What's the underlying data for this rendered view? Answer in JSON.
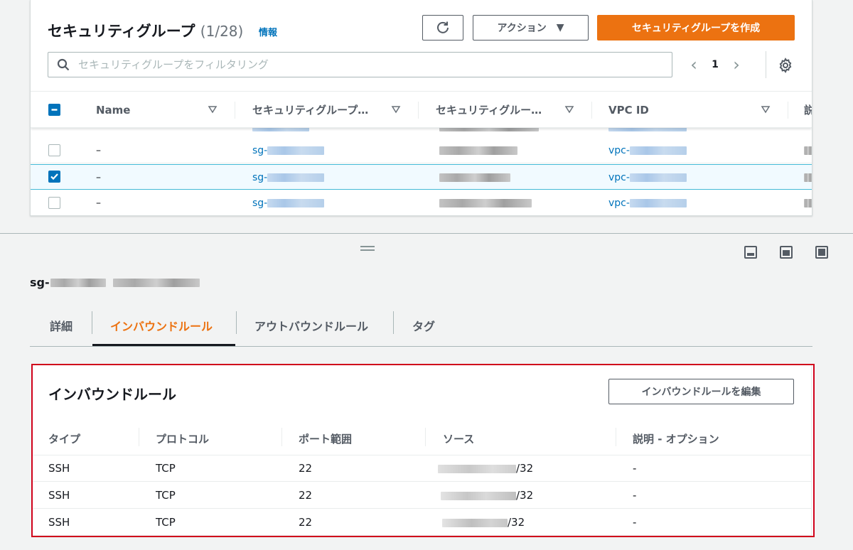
{
  "header": {
    "title": "セキュリティグループ",
    "count": "(1/28)",
    "info": "情報",
    "actions_label": "アクション",
    "create_label": "セキュリティグループを作成"
  },
  "search": {
    "placeholder": "セキュリティグループをフィルタリング",
    "value": ""
  },
  "pagination": {
    "current_page": "1"
  },
  "table": {
    "columns": [
      "Name",
      "セキュリティグループ…",
      "セキュリティグルー…",
      "VPC ID",
      "説"
    ],
    "rows": [
      {
        "name": "–",
        "group_id": "sg-",
        "vpc_id": "vpc-",
        "checked": false
      },
      {
        "name": "–",
        "group_id": "sg-",
        "vpc_id": "vpc-",
        "checked": true
      },
      {
        "name": "–",
        "group_id": "sg-",
        "vpc_id": "vpc-",
        "checked": false
      }
    ]
  },
  "detail": {
    "id_prefix": "sg-",
    "tabs": [
      "詳細",
      "インバウンドルール",
      "アウトバウンドルール",
      "タグ"
    ],
    "active_tab": 1
  },
  "inbound": {
    "title": "インバウンドルール",
    "edit_label": "インバウンドルールを編集",
    "columns": [
      "タイプ",
      "プロトコル",
      "ポート範囲",
      "ソース",
      "説明 - オプション"
    ],
    "rows": [
      {
        "type": "SSH",
        "protocol": "TCP",
        "port": "22",
        "source_suffix": "/32",
        "description": "-"
      },
      {
        "type": "SSH",
        "protocol": "TCP",
        "port": "22",
        "source_suffix": "/32",
        "description": "-"
      },
      {
        "type": "SSH",
        "protocol": "TCP",
        "port": "22",
        "source_suffix": "/32",
        "description": "-"
      }
    ]
  },
  "colors": {
    "accent": "#ec7211",
    "link": "#0073bb",
    "highlight_border": "#d0021b",
    "selected_row": "#f1faff"
  },
  "icons": [
    "refresh-icon",
    "caret-down-icon",
    "search-icon",
    "chevron-left-icon",
    "chevron-right-icon",
    "gear-icon",
    "checkbox-indeterminate-icon",
    "checkmark-icon",
    "sort-icon",
    "drag-handle-icon",
    "layout-bottom-icon",
    "layout-side-icon",
    "layout-full-icon"
  ]
}
